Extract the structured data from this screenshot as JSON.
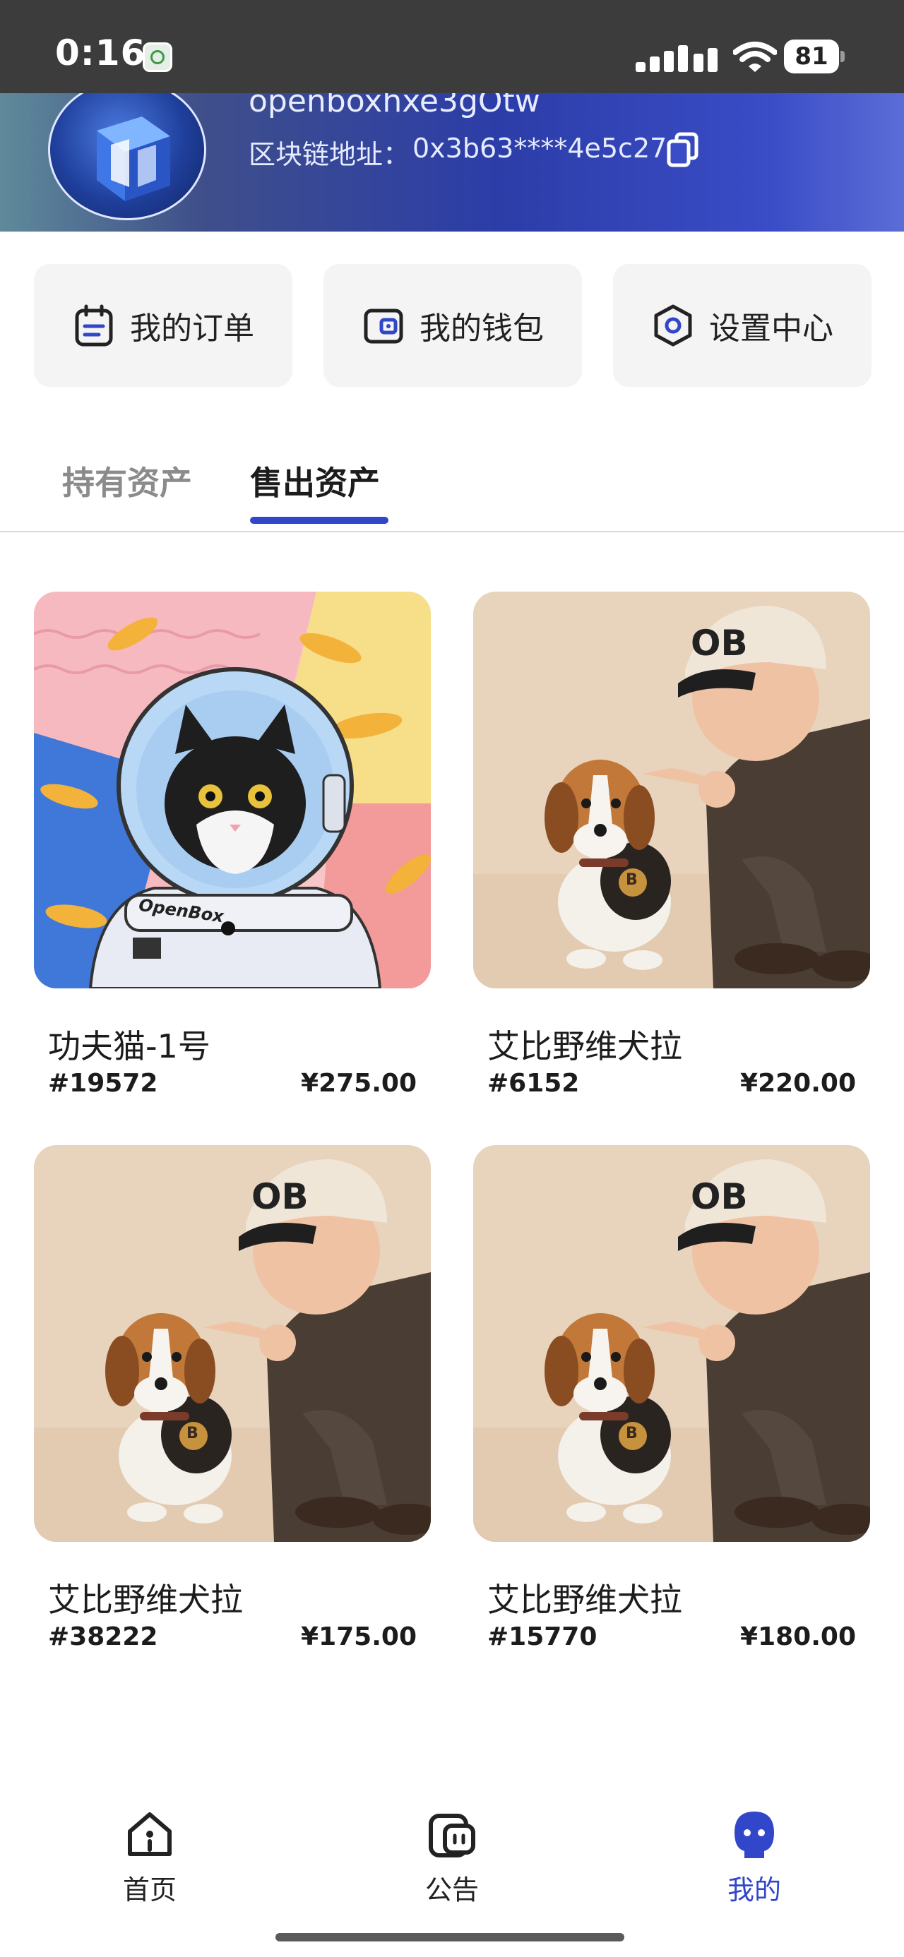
{
  "status_bar": {
    "time": "0:16",
    "battery": "81"
  },
  "profile": {
    "nickname": "openboxhxe3gOtw",
    "address_label": "区块链地址：",
    "address_value": "0x3b63****4e5c27"
  },
  "quick_actions": [
    {
      "label": "我的订单",
      "icon": "order-icon"
    },
    {
      "label": "我的钱包",
      "icon": "wallet-icon"
    },
    {
      "label": "设置中心",
      "icon": "settings-icon"
    }
  ],
  "tabs": [
    {
      "label": "持有资产",
      "active": false
    },
    {
      "label": "售出资产",
      "active": true
    }
  ],
  "assets": [
    {
      "name": "功夫猫-1号",
      "token": "#19572",
      "price": "¥275.00",
      "image": "astronaut-cat"
    },
    {
      "name": "艾比野维犬拉",
      "token": "#6152",
      "price": "¥220.00",
      "image": "beagle-and-man"
    },
    {
      "name": "艾比野维犬拉",
      "token": "#38222",
      "price": "¥175.00",
      "image": "beagle-and-man"
    },
    {
      "name": "艾比野维犬拉",
      "token": "#15770",
      "price": "¥180.00",
      "image": "beagle-and-man"
    }
  ],
  "cat_image": {
    "brand_text": "OpenBox"
  },
  "dog_image": {
    "cap_text": "OB",
    "tag_text": "B"
  },
  "bottom_nav": [
    {
      "label": "首页",
      "icon": "home-icon",
      "active": false
    },
    {
      "label": "公告",
      "icon": "announcement-icon",
      "active": false
    },
    {
      "label": "我的",
      "icon": "profile-icon",
      "active": true
    }
  ],
  "colors": {
    "accent": "#3246c9",
    "inactive": "#8b8b8b",
    "card_bg": "#f4f4f4"
  }
}
